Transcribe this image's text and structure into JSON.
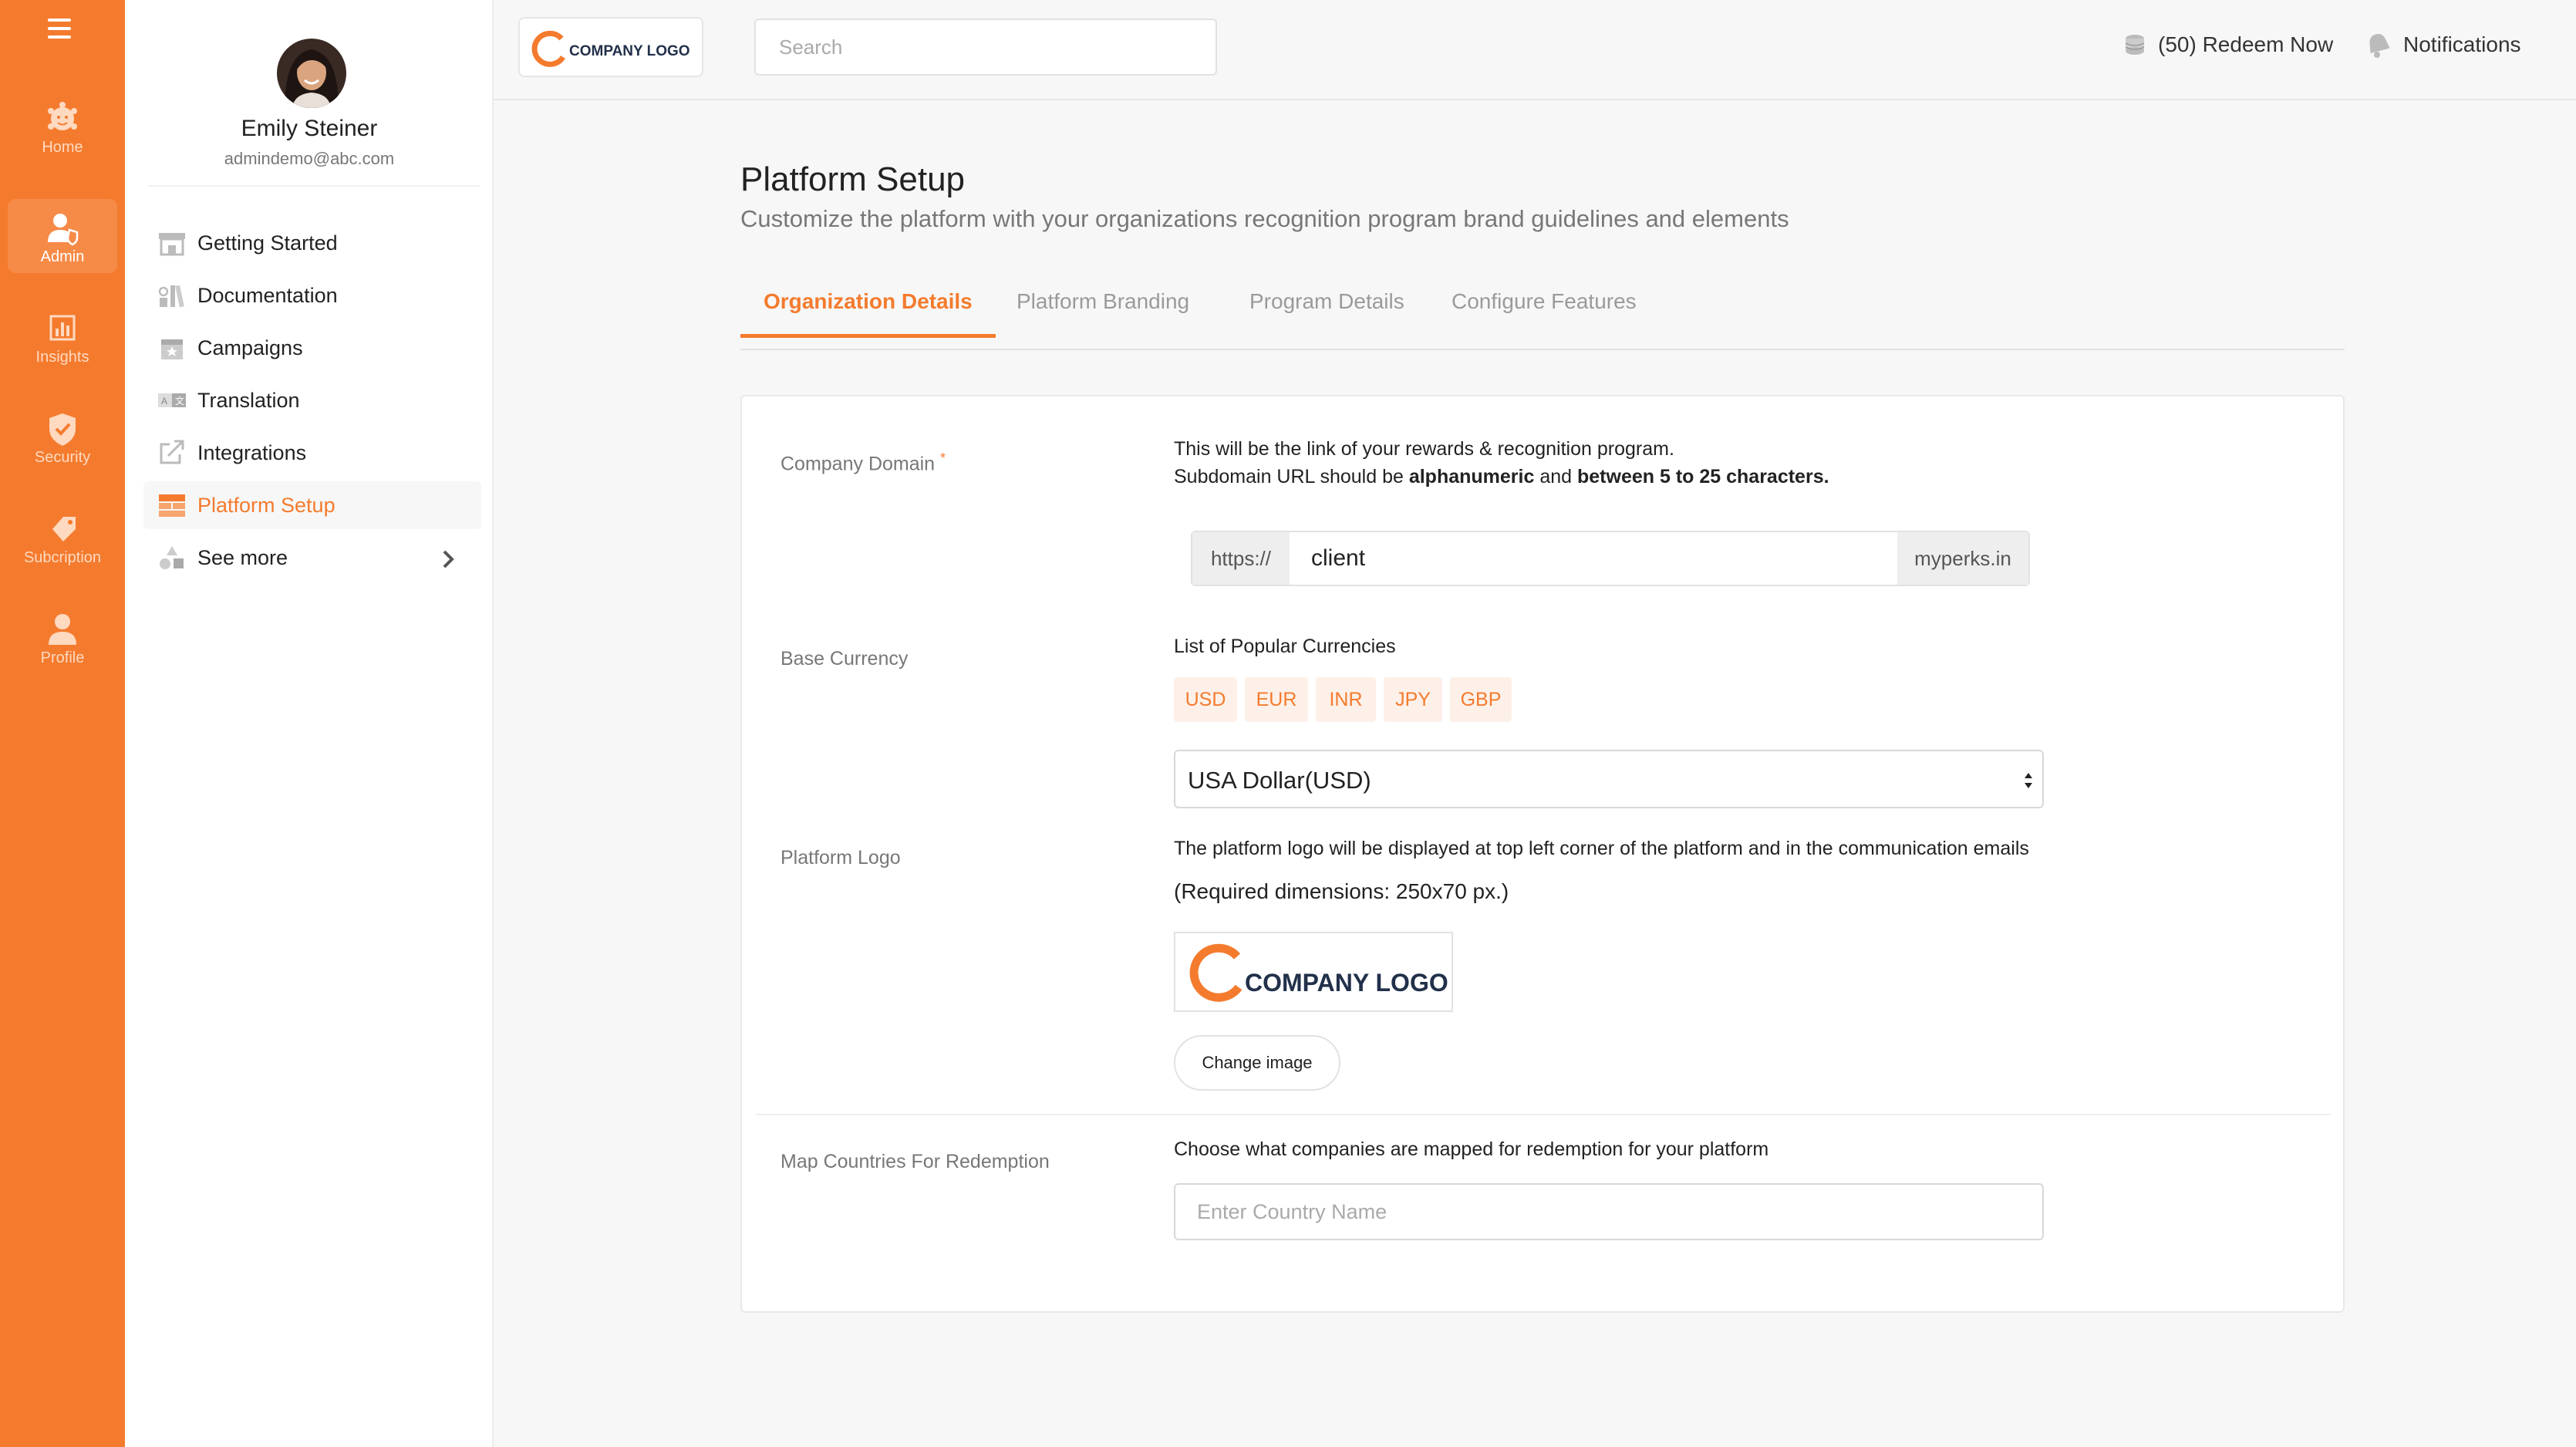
{
  "rail": {
    "items": [
      {
        "label": "Home",
        "icon": "home-icon"
      },
      {
        "label": "Admin",
        "icon": "admin-icon"
      },
      {
        "label": "Insights",
        "icon": "insights-icon"
      },
      {
        "label": "Security",
        "icon": "security-icon"
      },
      {
        "label": "Subcription",
        "icon": "subscription-icon"
      },
      {
        "label": "Profile",
        "icon": "profile-icon"
      }
    ]
  },
  "user": {
    "name": "Emily Steiner",
    "email": "admindemo@abc.com"
  },
  "sidebar": {
    "items": [
      {
        "label": "Getting Started",
        "icon": "store-icon"
      },
      {
        "label": "Documentation",
        "icon": "books-icon"
      },
      {
        "label": "Campaigns",
        "icon": "calendar-star-icon"
      },
      {
        "label": "Translation",
        "icon": "translate-icon"
      },
      {
        "label": "Integrations",
        "icon": "external-link-icon"
      },
      {
        "label": "Platform Setup",
        "icon": "layout-icon",
        "active": true
      },
      {
        "label": "See more",
        "icon": "shapes-icon"
      }
    ]
  },
  "header": {
    "logo_text": "COMPANY LOGO",
    "search_placeholder": "Search",
    "redeem_label": "(50) Redeem Now",
    "notifications_label": "Notifications"
  },
  "page": {
    "title": "Platform Setup",
    "subtitle": "Customize the platform with your organizations recognition program brand guidelines and elements"
  },
  "tabs": [
    {
      "label": "Organization Details",
      "active": true
    },
    {
      "label": "Platform Branding"
    },
    {
      "label": "Program Details"
    },
    {
      "label": "Configure Features"
    }
  ],
  "form": {
    "domain": {
      "label": "Company Domain",
      "required_mark": "*",
      "help1": "This will be the link of your rewards & recognition program.",
      "help2_pre": "Subdomain URL should be ",
      "help2_b1": "alphanumeric",
      "help2_mid": " and ",
      "help2_b2": "between 5 to 25 characters.",
      "prefix": "https://",
      "value": "client",
      "suffix": "myperks.in"
    },
    "currency": {
      "label": "Base Currency",
      "popular_label": "List of Popular Currencies",
      "chips": [
        "USD",
        "EUR",
        "INR",
        "JPY",
        "GBP"
      ],
      "selected": "USA Dollar(USD)"
    },
    "logo": {
      "label": "Platform Logo",
      "help1": "The platform logo will be displayed at top left corner of the platform and in the communication emails",
      "help2": "(Required dimensions: 250x70 px.)",
      "logo_text": "COMPANY LOGO",
      "change_button": "Change image"
    },
    "countries": {
      "label": "Map Countries For Redemption",
      "help": "Choose what companies are mapped for redemption for your platform",
      "placeholder": "Enter Country Name"
    }
  },
  "colors": {
    "accent": "#f47b2e",
    "rail": "#f47b2e",
    "chip_bg": "#fdf0e8",
    "brand_navy": "#22304a"
  }
}
